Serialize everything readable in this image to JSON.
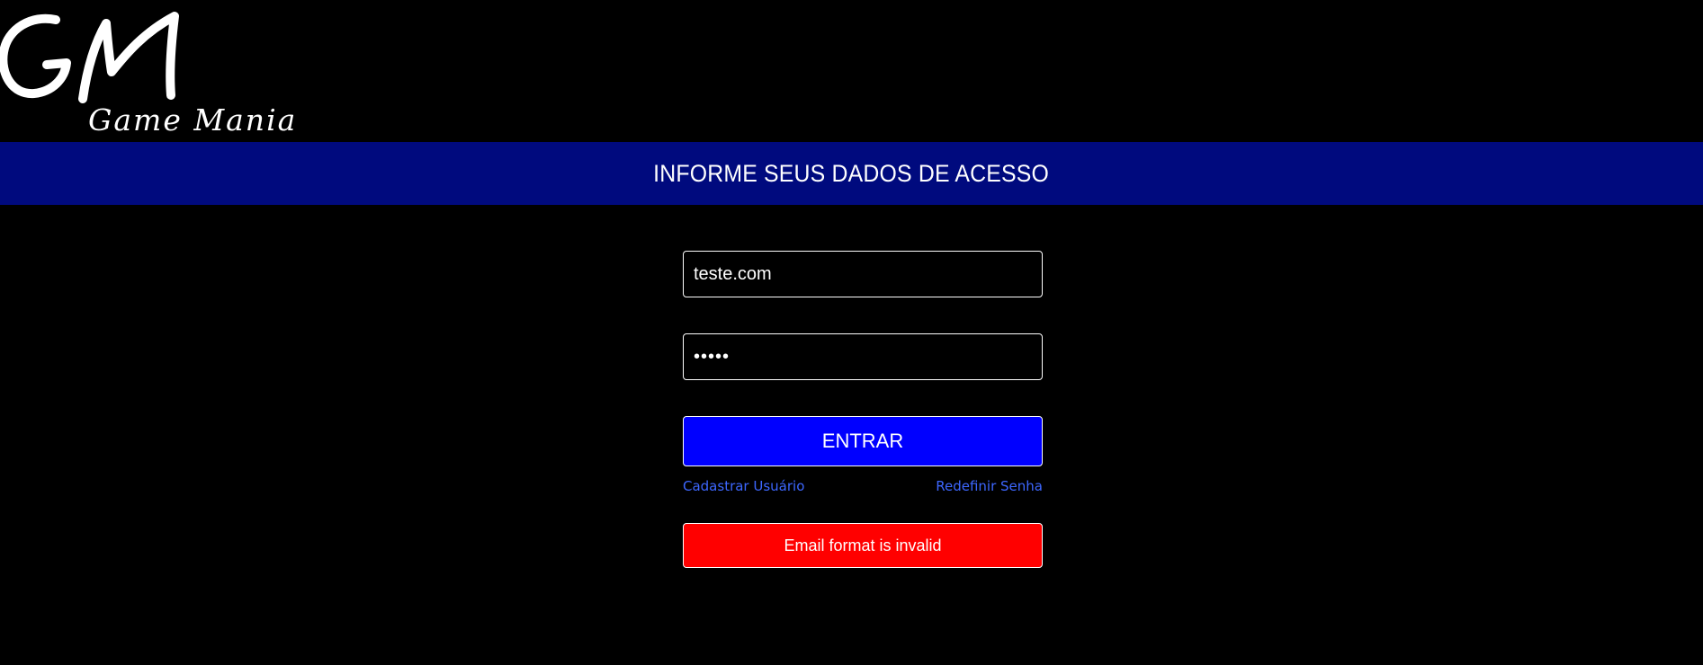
{
  "header": {
    "logo_mark": "GM",
    "logo_subtitle": "Game Mania"
  },
  "banner": {
    "title": "INFORME SEUS DADOS DE ACESSO"
  },
  "login_form": {
    "email_value": "teste.com",
    "password_masked": "•••••",
    "submit_label": "ENTRAR",
    "register_link": "Cadastrar Usuário",
    "reset_link": "Redefinir Senha",
    "error_message": "Email format is invalid"
  },
  "colors": {
    "background": "#000000",
    "banner": "#000a7e",
    "button": "#0000ff",
    "link": "#3d67ff",
    "error": "#ff0000"
  }
}
